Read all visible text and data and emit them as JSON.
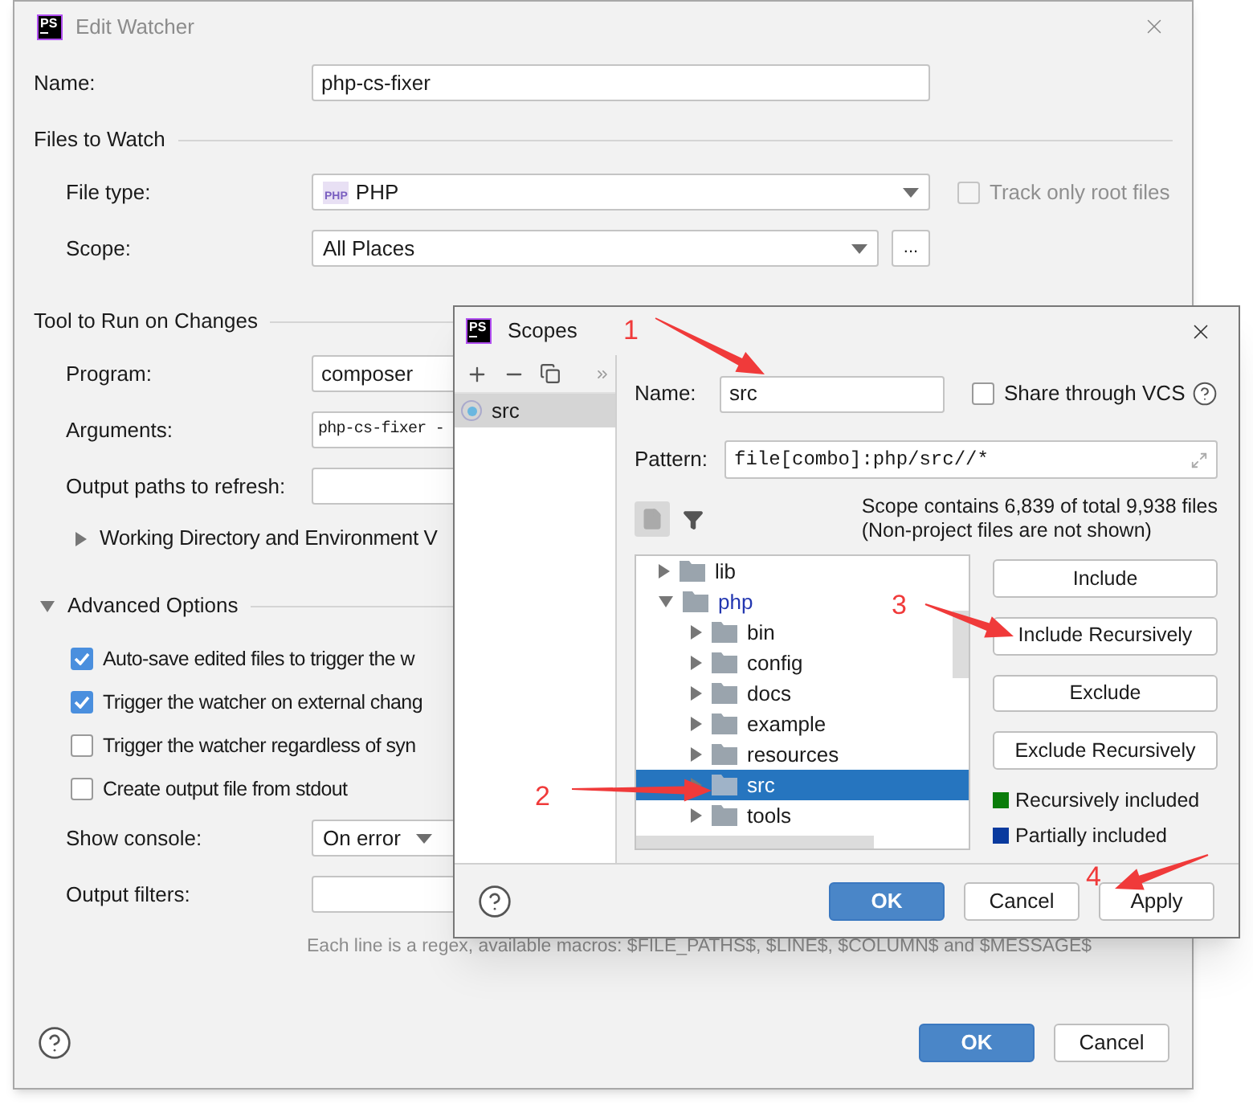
{
  "edit_watcher": {
    "logo": "PS",
    "title": "Edit Watcher",
    "name": {
      "label": "Name:",
      "value": "php-cs-fixer"
    },
    "files_section": "Files to Watch",
    "file_type": {
      "label": "File type:",
      "badge": "PHP",
      "value": "PHP"
    },
    "track_root": {
      "label": "Track only root files",
      "checked": false,
      "disabled": true
    },
    "scope": {
      "label": "Scope:",
      "value": "All Places",
      "browse": "..."
    },
    "tool_section": "Tool to Run on Changes",
    "program": {
      "label": "Program:",
      "value": "composer"
    },
    "arguments": {
      "label": "Arguments:",
      "value": "php-cs-fixer -"
    },
    "output_paths": {
      "label": "Output paths to refresh:"
    },
    "working_dir": {
      "label": "Working Directory and Environment V",
      "expanded": false
    },
    "advanced": {
      "label": "Advanced Options",
      "expanded": true
    },
    "options": [
      {
        "label": "Auto-save edited files to trigger the w",
        "checked": true
      },
      {
        "label": "Trigger the watcher on external chang",
        "checked": true
      },
      {
        "label": "Trigger the watcher regardless of syn",
        "checked": false
      },
      {
        "label": "Create output file from stdout",
        "checked": false
      }
    ],
    "show_console": {
      "label": "Show console:",
      "value": "On error"
    },
    "output_filters": {
      "label": "Output filters:",
      "hint": "Each line is a regex, available macros: $FILE_PATHS$, $LINE$, $COLUMN$ and $MESSAGE$"
    },
    "buttons": [
      {
        "label": "OK",
        "primary": true
      },
      {
        "label": "Cancel",
        "primary": false
      }
    ]
  },
  "scopes": {
    "logo": "PS",
    "title": "Scopes",
    "list": [
      {
        "label": "src",
        "selected": true
      }
    ],
    "name": {
      "label": "Name:",
      "value": "src"
    },
    "share": {
      "label": "Share through VCS",
      "checked": false
    },
    "pattern": {
      "label": "Pattern:",
      "value": "file[combo]:php/src//*"
    },
    "summary": [
      "Scope contains 6,839 of total 9,938 files",
      "(Non-project files are not shown)"
    ],
    "tree": [
      {
        "label": "lib",
        "expanded": false,
        "selected": false,
        "color": "#1a1a1a"
      },
      {
        "label": "php",
        "expanded": true,
        "selected": false,
        "color": "#2236b0",
        "children": [
          {
            "label": "bin",
            "expanded": false,
            "selected": false,
            "color": "#1a1a1a"
          },
          {
            "label": "config",
            "expanded": false,
            "selected": false,
            "color": "#1a1a1a"
          },
          {
            "label": "docs",
            "expanded": false,
            "selected": false,
            "color": "#1a1a1a"
          },
          {
            "label": "example",
            "expanded": false,
            "selected": false,
            "color": "#1a1a1a"
          },
          {
            "label": "resources",
            "expanded": false,
            "selected": false,
            "color": "#1a1a1a"
          },
          {
            "label": "src",
            "expanded": false,
            "selected": true
          },
          {
            "label": "tools",
            "expanded": false,
            "selected": false,
            "color": "#1a1a1a"
          }
        ]
      }
    ],
    "actions": [
      "Include",
      "Include Recursively",
      "Exclude",
      "Exclude Recursively"
    ],
    "legend": [
      {
        "label": "Recursively included",
        "color": "#0b7d0b"
      },
      {
        "label": "Partially included",
        "color": "#0a3a9e"
      }
    ],
    "buttons": [
      {
        "label": "OK",
        "primary": true
      },
      {
        "label": "Cancel",
        "primary": false
      },
      {
        "label": "Apply",
        "primary": false
      }
    ]
  },
  "annotations": [
    {
      "label": "1"
    },
    {
      "label": "2"
    },
    {
      "label": "3"
    },
    {
      "label": "4"
    }
  ]
}
